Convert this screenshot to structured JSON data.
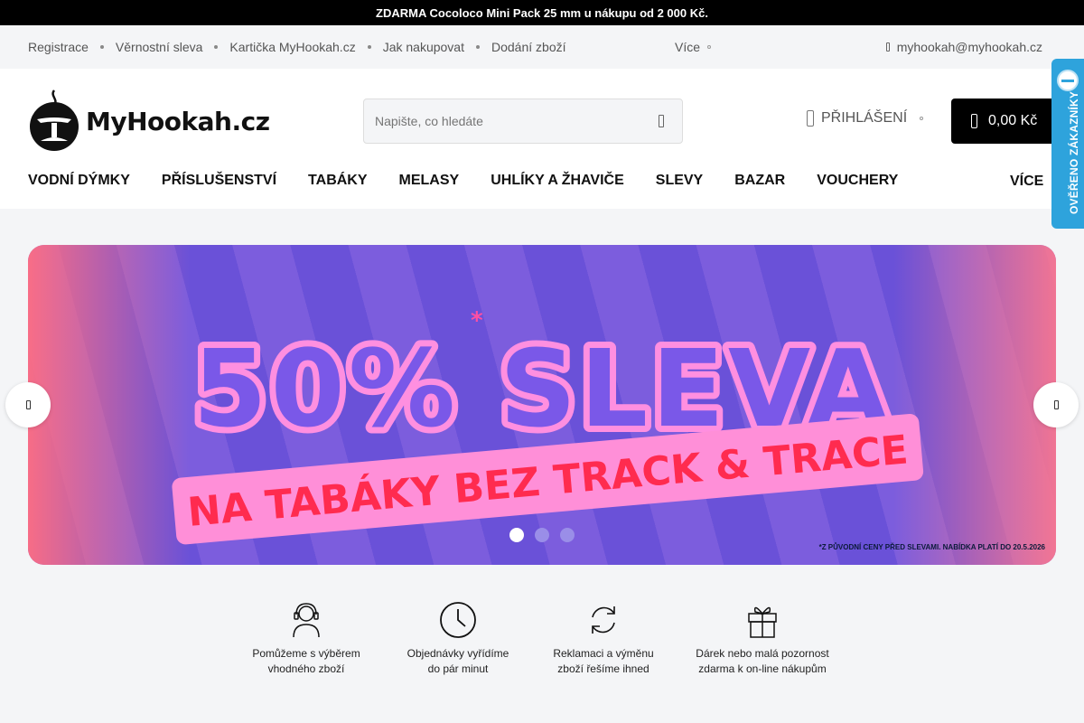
{
  "promo": {
    "text": "ZDARMA Cocoloco Mini Pack 25 mm u nákupu od 2 000 Kč."
  },
  "top_links": {
    "items": [
      "Registrace",
      "Věrnostní sleva",
      "Kartička MyHookah.cz",
      "Jak nakupovat",
      "Dodání zboží"
    ],
    "more": "Více",
    "email": "myhookah@myhookah.cz"
  },
  "header": {
    "logo_text": "MyHookah.cz",
    "search_placeholder": "Napište, co hledáte",
    "login_label": "PŘIHLÁŠENÍ",
    "cart_total": "0,00 Kč"
  },
  "nav": {
    "items": [
      "VODNÍ DÝMKY",
      "PŘÍSLUŠENSTVÍ",
      "TABÁKY",
      "MELASY",
      "UHLÍKY A ŽHAVIČE",
      "SLEVY",
      "BAZAR",
      "VOUCHERY"
    ],
    "more": "VÍCE"
  },
  "badge": {
    "text": "OVĚŘENO ZÁKAZNÍKY"
  },
  "hero": {
    "headline": "50% SLEVA",
    "asterisk": "*",
    "subline": "NA TABÁKY BEZ TRACK & TRACE",
    "footnote": "*Z PŮVODNÍ CENY PŘED SLEVAMI. NABÍDKA PLATÍ DO 20.5.2026",
    "slides_total": 3,
    "active_slide": 1
  },
  "benefits": [
    {
      "icon": "headset-icon",
      "line1": "Pomůžeme s výběrem",
      "line2": "vhodného zboží"
    },
    {
      "icon": "clock-icon",
      "line1": "Objednávky vyřídíme",
      "line2": "do pár minut"
    },
    {
      "icon": "refresh-icon",
      "line1": "Reklamaci a výměnu",
      "line2": "zboží řešíme ihned"
    },
    {
      "icon": "gift-icon",
      "line1": "Dárek nebo malá pozornost",
      "line2": "zdarma k on-line nákupům"
    }
  ],
  "colors": {
    "accent_blue": "#2ea3dc",
    "hero_purple": "#6a51d8",
    "hero_pink": "#ff4fa3",
    "sale_red": "#ff2b4f"
  }
}
